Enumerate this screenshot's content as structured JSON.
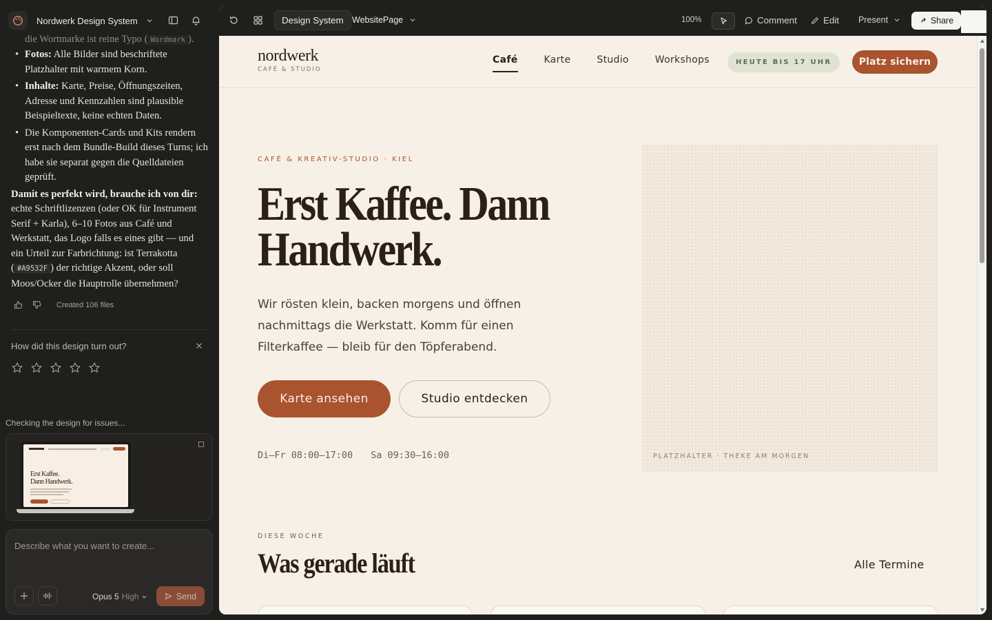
{
  "sidebar": {
    "project_title": "Nordwerk Design System",
    "chat": {
      "cut_line_prefix": "die Wortmarke ist reine Typo (",
      "cut_line_code": "Wordmark",
      "cut_line_suffix": ").",
      "bullets": [
        {
          "label": "Fotos:",
          "text": " Alle Bilder sind beschriftete Platzhalter mit warmem Korn."
        },
        {
          "label": "Inhalte:",
          "text": " Karte, Preise, Öffnungszeiten, Adresse und Kennzahlen sind plausible Beispieltexte, keine echten Daten."
        },
        {
          "label": "",
          "text": "Die Komponenten-Cards und Kits rendern erst nach dem Bundle-Build dieses Turns; ich habe sie separat gegen die Quelldateien geprüft."
        }
      ],
      "closing_bold": "Damit es perfekt wird, brauche ich von dir:",
      "closing_text_1": " echte Schriftlizenzen (oder OK für Instrument Serif + Karla), 6–10 Fotos aus Café und Werkstatt, das Logo falls es eines gibt — und ein Urteil zur Farbrichtung: ist Terrakotta (",
      "closing_code": "#A9532F",
      "closing_text_2": ") der richtige Akzent, oder soll Moos/Ocker die Hauptrolle übernehmen?"
    },
    "created_files": "Created 106 files",
    "rating_prompt": "How did this design turn out?",
    "checking_status": "Checking the design for issues...",
    "preview_mini_title_1": "Erst Kaffee.",
    "preview_mini_title_2": "Dann Handwerk.",
    "composer_placeholder": "Describe what you want to create...",
    "model_name": "Opus 5",
    "model_level": "High",
    "send_label": "Send"
  },
  "toolbar": {
    "design_system_tab": "Design System",
    "page_name": "WebsitePage",
    "zoom": "100%",
    "comment_label": "Comment",
    "edit_label": "Edit",
    "present_label": "Present",
    "share_label": "Share"
  },
  "site": {
    "brand_word": "nordwerk",
    "brand_sub": "CAFÉ & STUDIO",
    "nav": [
      "Café",
      "Karte",
      "Studio",
      "Workshops"
    ],
    "hours_pill": "HEUTE BIS 17 UHR",
    "cta_top": "Platz sichern",
    "eyebrow": "CAFÉ & KREATIV-STUDIO · KIEL",
    "hero_line_1": "Erst Kaffee. Dann",
    "hero_line_2": "Handwerk.",
    "lead": "Wir rösten klein, backen morgens und öffnen nachmittags die Werkstatt. Komm für einen Filterkaffee — bleib für den Töpferabend.",
    "btn_primary": "Karte ansehen",
    "btn_secondary": "Studio entdecken",
    "hours_weekday": "Di–Fr 08:00–17:00",
    "hours_saturday": "Sa 09:30–16:00",
    "placeholder_label": "PLATZHALTER · THEKE AM MORGEN",
    "week_eyebrow": "DIESE WOCHE",
    "week_title": "Was gerade läuft",
    "all_events": "Alle Termine"
  },
  "colors": {
    "accent": "#A9532F",
    "cream": "#F7F0E6",
    "ink": "#2B1F17",
    "moss_pill": "#DFE4D2"
  },
  "icons": [
    "palette-icon",
    "chevron-down-icon",
    "panel-toggle-icon",
    "bell-icon",
    "thumbs-up-icon",
    "thumbs-down-icon",
    "close-icon",
    "star-icon",
    "plus-icon",
    "waveform-icon",
    "send-icon",
    "refresh-icon",
    "components-icon",
    "pointer-icon",
    "comment-icon",
    "pencil-icon",
    "share-icon"
  ]
}
